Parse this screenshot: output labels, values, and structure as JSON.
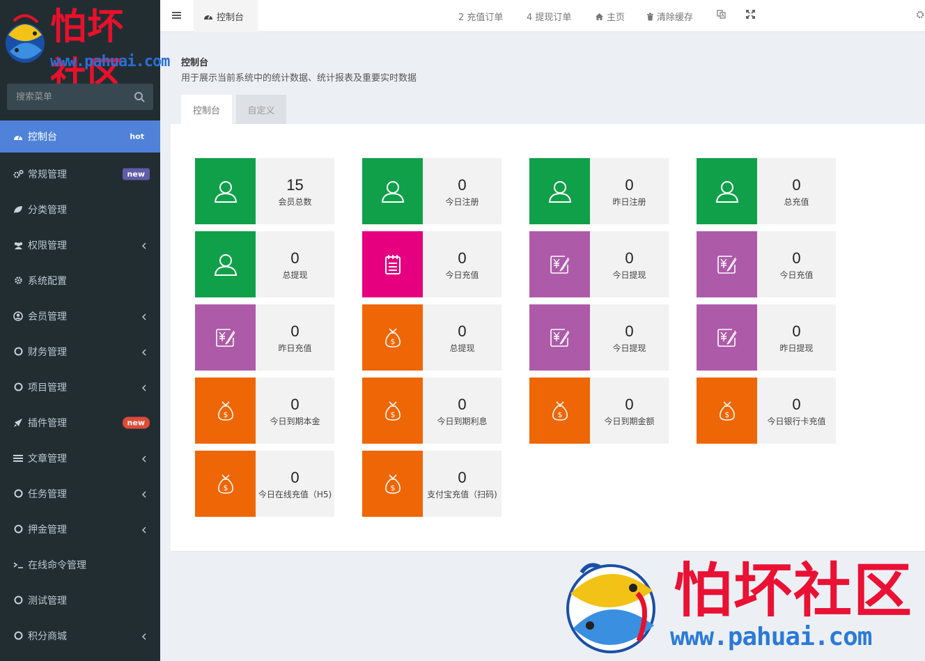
{
  "brand": {
    "title": "怕坏社区",
    "url": "www.pahuai.com"
  },
  "sidebar": {
    "search_placeholder": "搜索菜单",
    "items": [
      {
        "label": "控制台",
        "badge": "hot",
        "icon": "dashboard-icon",
        "active": true
      },
      {
        "label": "常规管理",
        "badge": "new",
        "icon": "cogs-icon"
      },
      {
        "label": "分类管理",
        "icon": "leaf-icon"
      },
      {
        "label": "权限管理",
        "icon": "group-icon",
        "expandable": true
      },
      {
        "label": "系统配置",
        "icon": "cog-icon"
      },
      {
        "label": "会员管理",
        "icon": "user-circle-icon",
        "expandable": true
      },
      {
        "label": "财务管理",
        "icon": "circle-icon",
        "expandable": true
      },
      {
        "label": "项目管理",
        "icon": "circle-icon",
        "expandable": true
      },
      {
        "label": "插件管理",
        "badge": "new",
        "icon": "rocket-icon"
      },
      {
        "label": "文章管理",
        "icon": "list-icon",
        "expandable": true
      },
      {
        "label": "任务管理",
        "icon": "circle-icon",
        "expandable": true
      },
      {
        "label": "押金管理",
        "icon": "circle-icon",
        "expandable": true
      },
      {
        "label": "在线命令管理",
        "icon": "terminal-icon"
      },
      {
        "label": "测试管理",
        "icon": "circle-icon"
      },
      {
        "label": "积分商城",
        "icon": "circle-icon",
        "expandable": true
      }
    ]
  },
  "navbar": {
    "current_tab": "控制台",
    "links": {
      "recharge_orders": "2 充值订单",
      "withdraw_orders": "4 提现订单",
      "home": "主页",
      "clear_cache": "清除缓存"
    }
  },
  "header": {
    "title": "控制台",
    "subtitle": "用于展示当前系统中的统计数据、统计报表及重要实时数据",
    "tabs": [
      "控制台",
      "自定义"
    ]
  },
  "cards": [
    {
      "value": "15",
      "label": "会员总数",
      "color": "#10a04a",
      "icon": "user-icon"
    },
    {
      "value": "0",
      "label": "今日注册",
      "color": "#10a04a",
      "icon": "user-icon"
    },
    {
      "value": "0",
      "label": "昨日注册",
      "color": "#10a04a",
      "icon": "user-icon"
    },
    {
      "value": "0",
      "label": "总充值",
      "color": "#10a04a",
      "icon": "user-icon"
    },
    {
      "value": "0",
      "label": "总提现",
      "color": "#10a04a",
      "icon": "user-icon"
    },
    {
      "value": "0",
      "label": "今日充值",
      "color": "#e6007f",
      "icon": "notepad-icon"
    },
    {
      "value": "0",
      "label": "今日提现",
      "color": "#ad5ba8",
      "icon": "yen-sign-icon"
    },
    {
      "value": "0",
      "label": "今日充值",
      "color": "#ad5ba8",
      "icon": "yen-sign-icon"
    },
    {
      "value": "0",
      "label": "昨日充值",
      "color": "#ad5ba8",
      "icon": "yen-sign-icon"
    },
    {
      "value": "0",
      "label": "总提现",
      "color": "#ee6605",
      "icon": "money-bag-icon"
    },
    {
      "value": "0",
      "label": "今日提现",
      "color": "#ad5ba8",
      "icon": "yen-sign-icon"
    },
    {
      "value": "0",
      "label": "昨日提现",
      "color": "#ad5ba8",
      "icon": "yen-sign-icon"
    },
    {
      "value": "0",
      "label": "今日到期本金",
      "color": "#ee6605",
      "icon": "money-bag-icon"
    },
    {
      "value": "0",
      "label": "今日到期利息",
      "color": "#ee6605",
      "icon": "money-bag-icon"
    },
    {
      "value": "0",
      "label": "今日到期金额",
      "color": "#ee6605",
      "icon": "money-bag-icon"
    },
    {
      "value": "0",
      "label": "今日银行卡充值",
      "color": "#ee6605",
      "icon": "money-bag-icon"
    },
    {
      "value": "0",
      "label": "今日在线充值（H5)",
      "color": "#ee6605",
      "icon": "money-bag-icon"
    },
    {
      "value": "0",
      "label": "支付宝充值（扫码)",
      "color": "#ee6605",
      "icon": "money-bag-icon"
    }
  ]
}
